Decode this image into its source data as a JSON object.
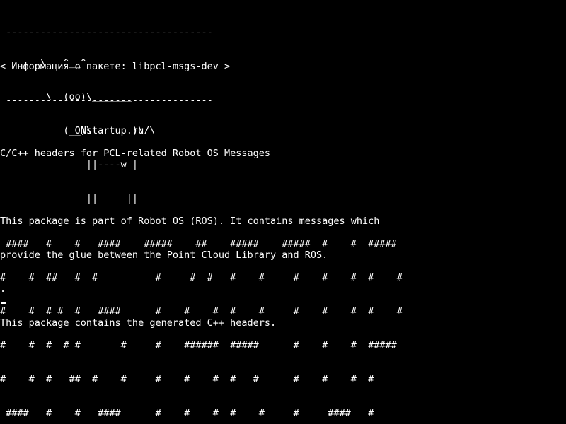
{
  "terminal": {
    "header": {
      "top_rule": " ------------------------------------",
      "title": "< Информация о пакете: libpcl-msgs-dev >",
      "bottom_rule": " ------------------------------------"
    },
    "cow": [
      "       \\   ^__^",
      "        \\  (oo)\\_______",
      "           (__)\\       )\\/\\",
      "               ||----w |",
      "               ||     ||"
    ],
    "site": "             ONstartup.ru",
    "description": {
      "summary": "C/C++ headers for PCL-related Robot OS Messages",
      "body": [
        "This package is part of Robot OS (ROS). It contains messages which",
        "provide the glue between the Point Cloud Library and ROS.",
        ".",
        "This package contains the generated C++ headers."
      ]
    },
    "banner": [
      " ####   #    #   ####    #####    ##    #####    #####  #    #  #####",
      "#    #  ##   #  #          #     #  #   #    #     #    #    #  #    #",
      "#    #  # #  #   ####      #    #    #  #    #     #    #    #  #    #",
      "#    #  #  # #       #     #    ######  #####      #    #    #  #####",
      "#    #  #   ##  #    #     #    #    #  #   #      #    #    #  #",
      " ####   #    #   ####      #    #    #  #    #     #     ####   #"
    ]
  },
  "colors": {
    "background": "#000000",
    "foreground": "#ffffff"
  }
}
